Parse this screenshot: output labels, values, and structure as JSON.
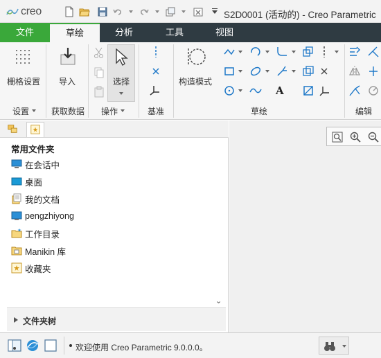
{
  "app": {
    "logo_text": "creo",
    "window_title": "S2D0001 (活动的) - Creo Parametric"
  },
  "quick_access": [
    {
      "icon": "new-file-icon"
    },
    {
      "icon": "open-folder-icon"
    },
    {
      "icon": "save-icon"
    },
    {
      "icon": "undo-icon"
    },
    {
      "icon": "redo-icon"
    },
    {
      "icon": "regenerate-icon"
    },
    {
      "icon": "close-window-icon"
    },
    {
      "icon": "customize-toolbar-icon"
    }
  ],
  "ribbon_tabs": [
    {
      "label": "文件",
      "kind": "file"
    },
    {
      "label": "草绘",
      "kind": "active"
    },
    {
      "label": "分析",
      "kind": "normal"
    },
    {
      "label": "工具",
      "kind": "normal"
    },
    {
      "label": "视图",
      "kind": "normal"
    }
  ],
  "ribbon": {
    "grid_settings": "栅格设置",
    "import": "导入",
    "select": "选择",
    "construction_mode": "构造模式",
    "groups": {
      "settings": "设置",
      "get_data": "获取数据",
      "operations": "操作",
      "datum": "基准",
      "sketch": "草绘",
      "edit": "编辑"
    },
    "text_tool_glyph": "A"
  },
  "navigator": {
    "common_folders_title": "常用文件夹",
    "items": [
      {
        "label": "在会话中",
        "icon": "in-session-icon"
      },
      {
        "label": "桌面",
        "icon": "desktop-icon"
      },
      {
        "label": "我的文档",
        "icon": "my-documents-icon"
      },
      {
        "label": "pengzhiyong",
        "icon": "user-folder-icon"
      },
      {
        "label": "工作目录",
        "icon": "working-directory-icon"
      },
      {
        "label": "Manikin 库",
        "icon": "manikin-library-icon"
      },
      {
        "label": "收藏夹",
        "icon": "favorites-icon"
      }
    ],
    "folder_tree_label": "文件夹树",
    "collapse_glyph": "⌄"
  },
  "status_bar": {
    "message": "欢迎使用 Creo Parametric 9.0.0.0。"
  },
  "colors": {
    "file_tab": "#3aa83a",
    "tab_bar": "#2f3b42",
    "accent_blue": "#1e78c8"
  }
}
